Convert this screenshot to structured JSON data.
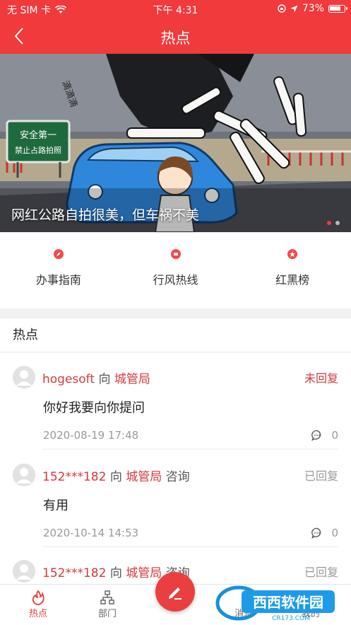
{
  "status_bar": {
    "carrier": "无 SIM 卡",
    "time": "下午 4:31",
    "battery": "73%"
  },
  "nav": {
    "title": "热点"
  },
  "banner": {
    "caption": "网红公路自拍很美，但车祸不美",
    "sign_line1": "安全第一",
    "sign_line2": "禁止占路拍照",
    "sfx": "滴滴滴"
  },
  "quick_links": [
    {
      "label": "办事指南",
      "icon": "compass-icon",
      "color": "#f04a4c"
    },
    {
      "label": "行风热线",
      "icon": "phone-icon",
      "color": "#f04a4c"
    },
    {
      "label": "红黑榜",
      "icon": "star-icon",
      "color": "#f04a4c"
    }
  ],
  "section": {
    "title": "热点"
  },
  "posts": [
    {
      "user": "hogesoft",
      "conj": "向",
      "dept": "城管局",
      "type": "",
      "status": "未回复",
      "status_kind": "unreplied",
      "content": "你好我要向你提问",
      "time": "2020-08-19 17:48",
      "comments": "0"
    },
    {
      "user": "152***182",
      "conj": "向",
      "dept": "城管局",
      "type": "咨询",
      "status": "已回复",
      "status_kind": "replied",
      "content": "有用",
      "time": "2020-10-14 14:53",
      "comments": "0"
    },
    {
      "user": "152***182",
      "conj": "向",
      "dept": "城管局",
      "type": "咨询",
      "status": "已回复",
      "status_kind": "replied"
    }
  ],
  "tabs": {
    "hot": "热点",
    "dept": "部门",
    "msg": "消息",
    "me": "我的"
  },
  "watermark": {
    "text": "西西软件园",
    "url": "CR173.COM"
  },
  "colors": {
    "brand": "#f03a3c",
    "accent_text": "#d33a3e"
  }
}
